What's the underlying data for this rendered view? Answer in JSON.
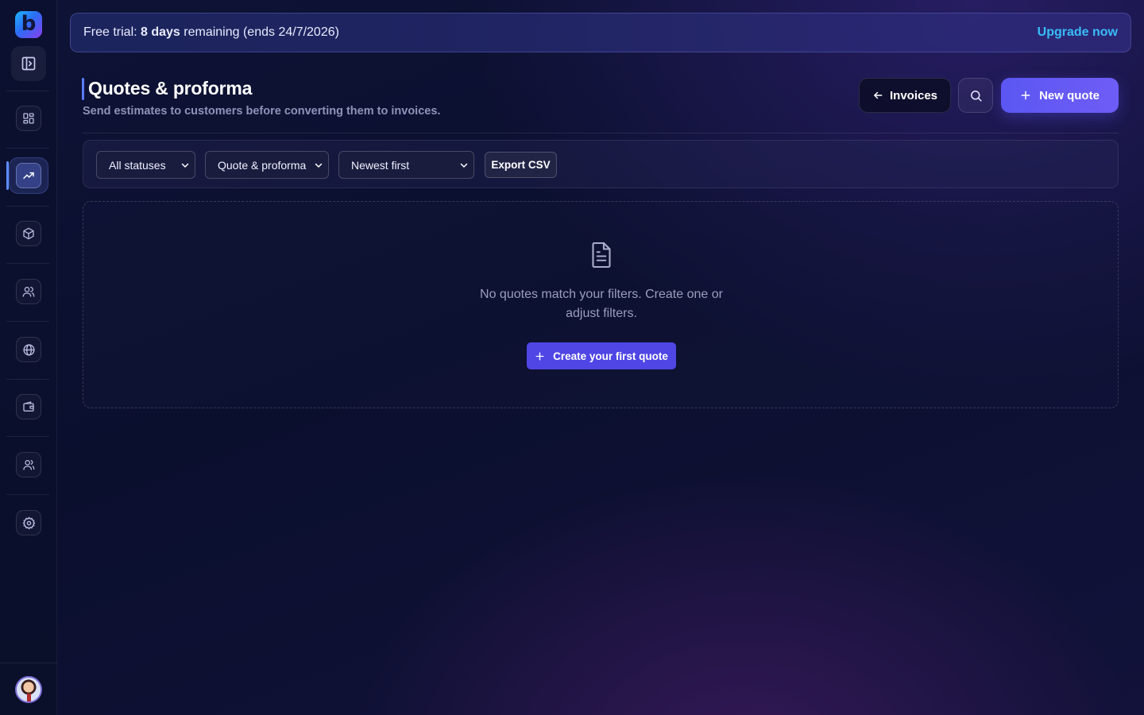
{
  "banner": {
    "prefix": "Free trial: ",
    "days": "8 days",
    "suffix": " remaining (ends 24/7/2026)",
    "upgrade_label": "Upgrade now"
  },
  "sidebar": {
    "logo_letter": "b",
    "items": [
      {
        "name": "dashboard",
        "icon": "grid-icon"
      },
      {
        "name": "sales",
        "icon": "trending-up-icon",
        "active": true
      },
      {
        "name": "products",
        "icon": "box-icon"
      },
      {
        "name": "customers",
        "icon": "users-icon"
      },
      {
        "name": "website",
        "icon": "globe-icon"
      },
      {
        "name": "wallet",
        "icon": "wallet-icon"
      },
      {
        "name": "team",
        "icon": "team-icon"
      },
      {
        "name": "settings",
        "icon": "gear-icon"
      }
    ]
  },
  "header": {
    "title": "Quotes & proforma",
    "subtitle": "Send estimates to customers before converting them to invoices.",
    "invoices_label": "Invoices",
    "new_quote_label": "New quote"
  },
  "filters": {
    "status": "All statuses",
    "type": "Quote & proforma",
    "sort": "Newest first",
    "export_label": "Export CSV"
  },
  "empty_state": {
    "message": "No quotes match your filters. Create one or adjust filters.",
    "create_label": "Create your first quote"
  },
  "colors": {
    "accent": "#5b57f2",
    "link": "#38bdf8",
    "background": "#0d0f2e"
  }
}
